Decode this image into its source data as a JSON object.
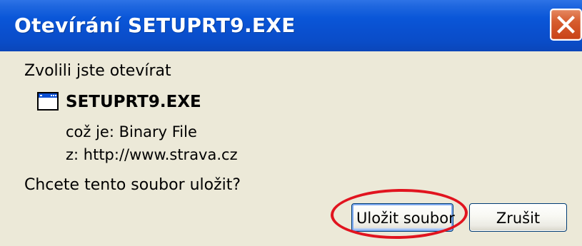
{
  "window": {
    "title": "Otevírání SETUPRT9.EXE",
    "close_icon": "close-icon"
  },
  "dialog": {
    "prompt": "Zvolili jste otevírat",
    "file_icon": "application-window-icon",
    "filename": "SETUPRT9.EXE",
    "type_line": "což je:  Binary File",
    "from_line": "z:  http://www.strava.cz",
    "question": "Chcete tento soubor uložit?"
  },
  "buttons": {
    "save": "Uložit soubor",
    "cancel": "Zrušit"
  },
  "annotation": {
    "color": "#e1141f"
  },
  "colors": {
    "titlebar": "#0a50cf",
    "dialog_background": "#ece9d8",
    "close_button": "#d65c2e"
  }
}
